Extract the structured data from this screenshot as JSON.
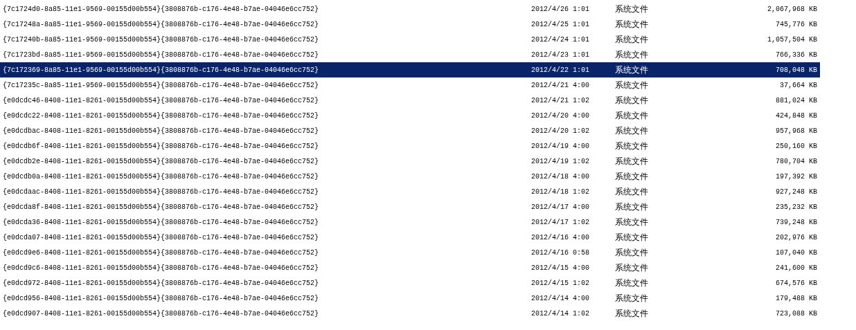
{
  "rows": [
    {
      "name": "{7c1724d0-8a85-11e1-9569-00155d00b554}{3808876b-c176-4e48-b7ae-04046e6cc752}",
      "date": "2012/4/26 1:01",
      "type": "系统文件",
      "size": "2,067,968 KB",
      "selected": false
    },
    {
      "name": "{7c17248a-8a85-11e1-9569-00155d00b554}{3808876b-c176-4e48-b7ae-04046e6cc752}",
      "date": "2012/4/25 1:01",
      "type": "系统文件",
      "size": "745,776 KB",
      "selected": false
    },
    {
      "name": "{7c17240b-8a85-11e1-9569-00155d00b554}{3808876b-c176-4e48-b7ae-04046e6cc752}",
      "date": "2012/4/24 1:01",
      "type": "系统文件",
      "size": "1,057,504 KB",
      "selected": false
    },
    {
      "name": "{7c1723bd-8a85-11e1-9569-00155d00b554}{3808876b-c176-4e48-b7ae-04046e6cc752}",
      "date": "2012/4/23 1:01",
      "type": "系统文件",
      "size": "766,336 KB",
      "selected": false
    },
    {
      "name": "{7c172369-8a85-11e1-9569-00155d00b554}{3808876b-c176-4e48-b7ae-04046e6cc752}",
      "date": "2012/4/22 1:01",
      "type": "系统文件",
      "size": "708,048 KB",
      "selected": true
    },
    {
      "name": "{7c17235c-8a85-11e1-9569-00155d00b554}{3808876b-c176-4e48-b7ae-04046e6cc752}",
      "date": "2012/4/21 4:00",
      "type": "系统文件",
      "size": "37,664 KB",
      "selected": false
    },
    {
      "name": "{e0dcdc46-8408-11e1-8261-00155d00b554}{3808876b-c176-4e48-b7ae-04046e6cc752}",
      "date": "2012/4/21 1:02",
      "type": "系统文件",
      "size": "881,024 KB",
      "selected": false
    },
    {
      "name": "{e0dcdc22-8408-11e1-8261-00155d00b554}{3808876b-c176-4e48-b7ae-04046e6cc752}",
      "date": "2012/4/20 4:00",
      "type": "系统文件",
      "size": "424,848 KB",
      "selected": false
    },
    {
      "name": "{e0dcdbac-8408-11e1-8261-00155d00b554}{3808876b-c176-4e48-b7ae-04046e6cc752}",
      "date": "2012/4/20 1:02",
      "type": "系统文件",
      "size": "957,968 KB",
      "selected": false
    },
    {
      "name": "{e0dcdb6f-8408-11e1-8261-00155d00b554}{3808876b-c176-4e48-b7ae-04046e6cc752}",
      "date": "2012/4/19 4:00",
      "type": "系统文件",
      "size": "250,160 KB",
      "selected": false
    },
    {
      "name": "{e0dcdb2e-8408-11e1-8261-00155d00b554}{3808876b-c176-4e48-b7ae-04046e6cc752}",
      "date": "2012/4/19 1:02",
      "type": "系统文件",
      "size": "780,704 KB",
      "selected": false
    },
    {
      "name": "{e0dcdb0a-8408-11e1-8261-00155d00b554}{3808876b-c176-4e48-b7ae-04046e6cc752}",
      "date": "2012/4/18 4:00",
      "type": "系统文件",
      "size": "197,392 KB",
      "selected": false
    },
    {
      "name": "{e0dcdaac-8408-11e1-8261-00155d00b554}{3808876b-c176-4e48-b7ae-04046e6cc752}",
      "date": "2012/4/18 1:02",
      "type": "系统文件",
      "size": "927,248 KB",
      "selected": false
    },
    {
      "name": "{e0dcda8f-8408-11e1-8261-00155d00b554}{3808876b-c176-4e48-b7ae-04046e6cc752}",
      "date": "2012/4/17 4:00",
      "type": "系统文件",
      "size": "235,232 KB",
      "selected": false
    },
    {
      "name": "{e0dcda36-8408-11e1-8261-00155d00b554}{3808876b-c176-4e48-b7ae-04046e6cc752}",
      "date": "2012/4/17 1:02",
      "type": "系统文件",
      "size": "739,248 KB",
      "selected": false
    },
    {
      "name": "{e0dcda07-8408-11e1-8261-00155d00b554}{3808876b-c176-4e48-b7ae-04046e6cc752}",
      "date": "2012/4/16 4:00",
      "type": "系统文件",
      "size": "202,976 KB",
      "selected": false
    },
    {
      "name": "{e0dcd9e6-8408-11e1-8261-00155d00b554}{3808876b-c176-4e48-b7ae-04046e6cc752}",
      "date": "2012/4/16 0:58",
      "type": "系统文件",
      "size": "107,040 KB",
      "selected": false
    },
    {
      "name": "{e0dcd9c6-8408-11e1-8261-00155d00b554}{3808876b-c176-4e48-b7ae-04046e6cc752}",
      "date": "2012/4/15 4:00",
      "type": "系统文件",
      "size": "241,600 KB",
      "selected": false
    },
    {
      "name": "{e0dcd972-8408-11e1-8261-00155d00b554}{3808876b-c176-4e48-b7ae-04046e6cc752}",
      "date": "2012/4/15 1:02",
      "type": "系统文件",
      "size": "674,576 KB",
      "selected": false
    },
    {
      "name": "{e0dcd956-8408-11e1-8261-00155d00b554}{3808876b-c176-4e48-b7ae-04046e6cc752}",
      "date": "2012/4/14 4:00",
      "type": "系统文件",
      "size": "179,488 KB",
      "selected": false
    },
    {
      "name": "{e0dcd907-8408-11e1-8261-00155d00b554}{3808876b-c176-4e48-b7ae-04046e6cc752}",
      "date": "2012/4/14 1:02",
      "type": "系统文件",
      "size": "723,088 KB",
      "selected": false
    }
  ]
}
